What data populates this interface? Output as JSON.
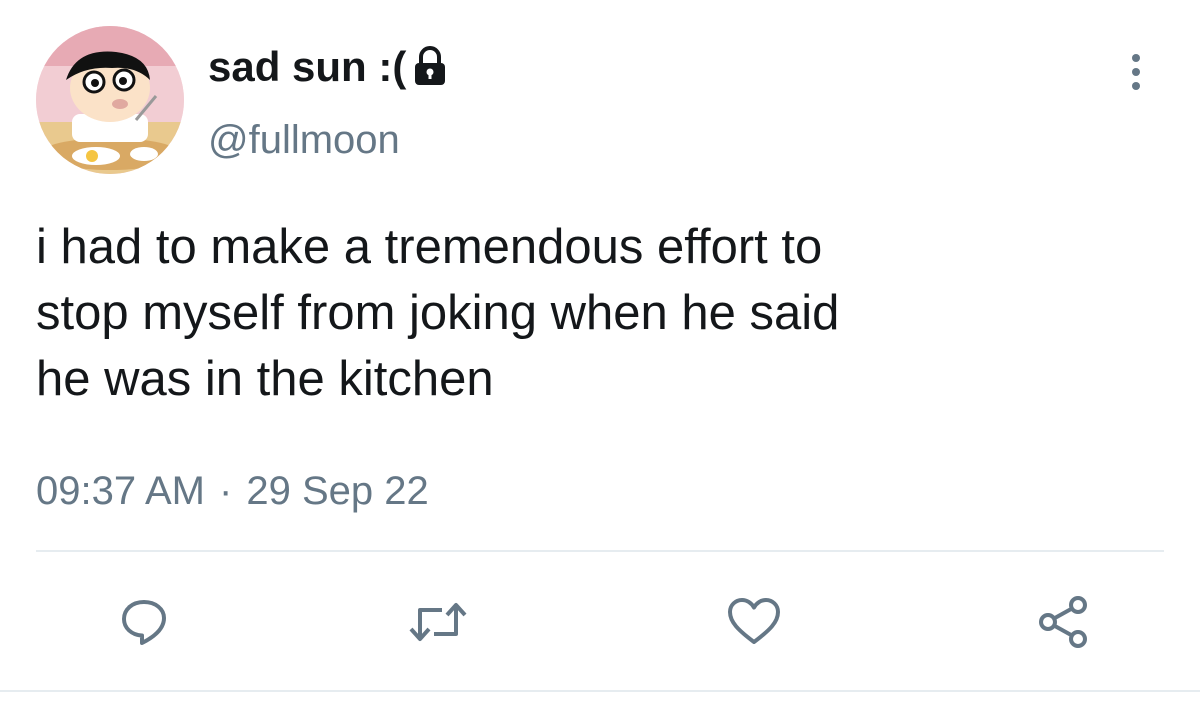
{
  "user": {
    "display_name": "sad sun :(",
    "handle": "@fullmoon",
    "protected_icon": "lock-icon",
    "avatar": "cartoon-boy-avatar"
  },
  "tweet": {
    "text": "i had to make a tremendous effort to\nstop myself from joking when he said\nhe was in the kitchen",
    "time": "09:37 AM",
    "separator": "·",
    "date": "29 Sep 22"
  },
  "actions": [
    {
      "name": "reply",
      "icon": "reply-icon"
    },
    {
      "name": "retweet",
      "icon": "retweet-icon"
    },
    {
      "name": "like",
      "icon": "heart-icon"
    },
    {
      "name": "share",
      "icon": "share-icon"
    }
  ],
  "colors": {
    "text": "#14171a",
    "secondary": "#657786",
    "divider": "#e6ecf0"
  }
}
